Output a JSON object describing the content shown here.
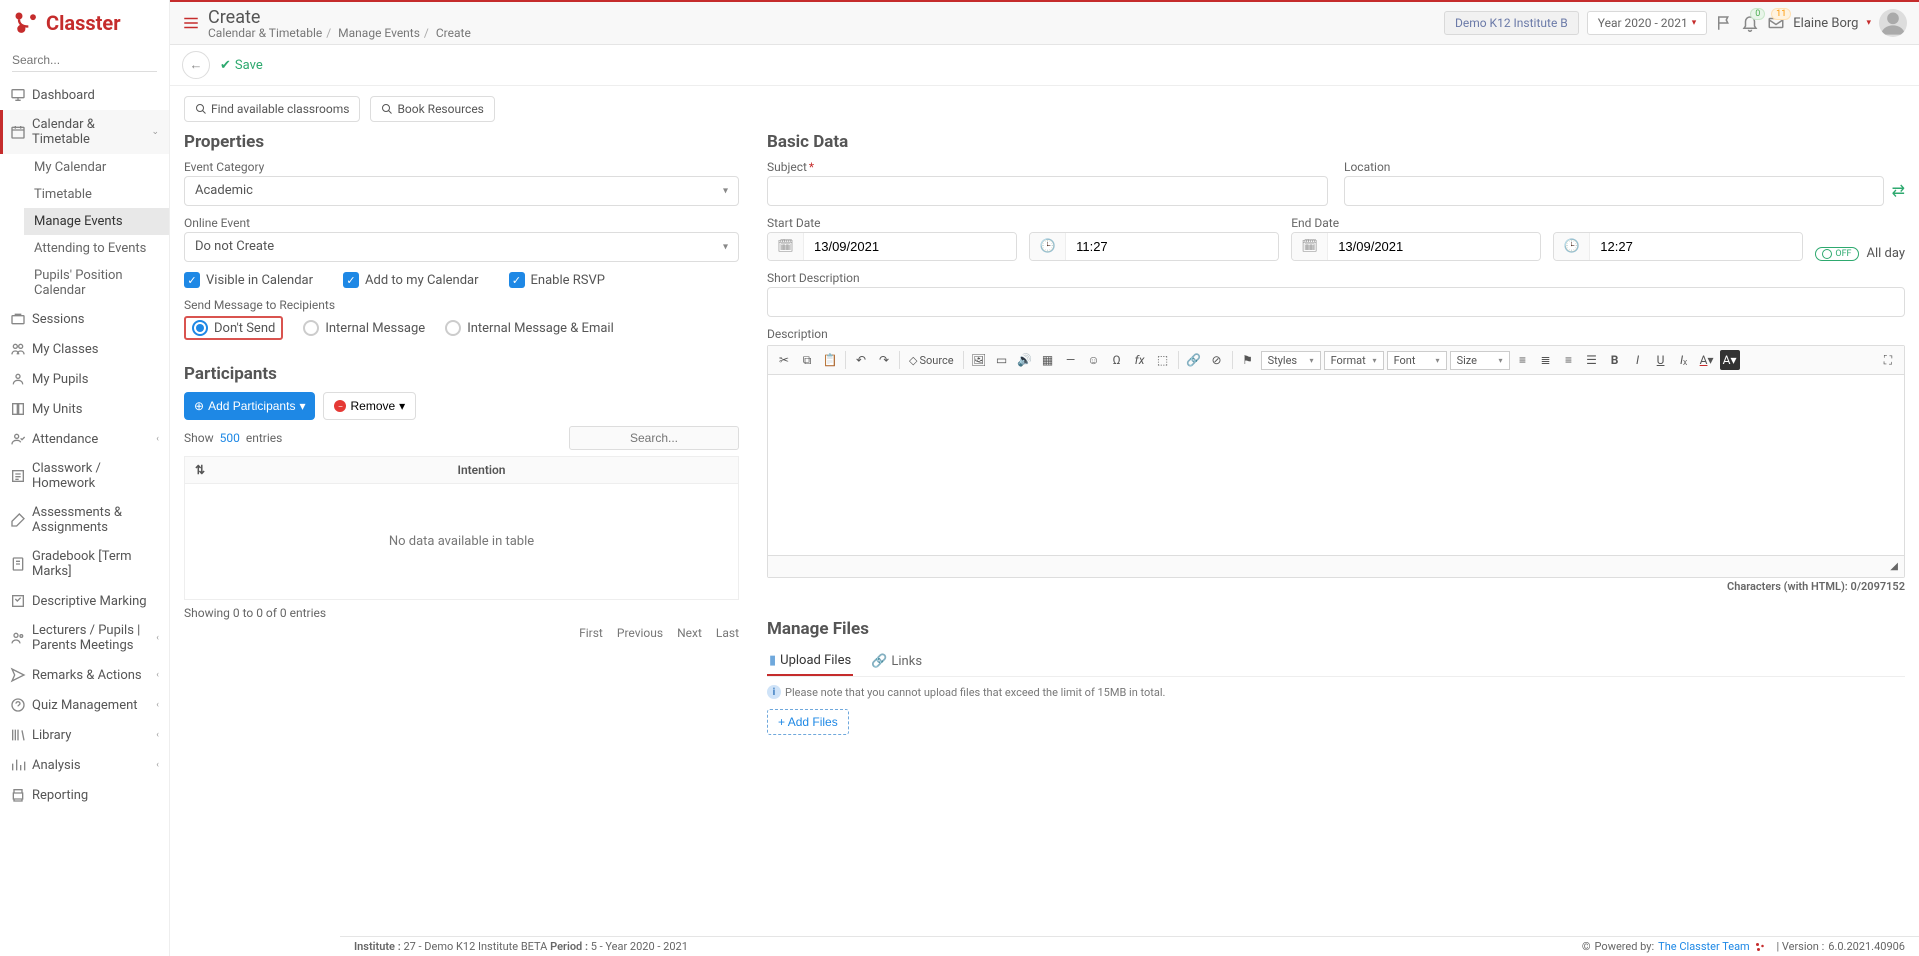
{
  "brand": "Classter",
  "sidebar_search_placeholder": "Search...",
  "nav": {
    "dashboard": "Dashboard",
    "calendar": "Calendar & Timetable",
    "calendar_sub": {
      "my_calendar": "My Calendar",
      "timetable": "Timetable",
      "manage_events": "Manage Events",
      "attending": "Attending to Events",
      "pupils_position": "Pupils' Position Calendar"
    },
    "sessions": "Sessions",
    "my_classes": "My Classes",
    "my_pupils": "My Pupils",
    "my_units": "My Units",
    "attendance": "Attendance",
    "classwork": "Classwork / Homework",
    "assessments": "Assessments & Assignments",
    "gradebook": "Gradebook [Term Marks]",
    "descriptive": "Descriptive Marking",
    "lecturers": "Lecturers / Pupils | Parents Meetings",
    "remarks": "Remarks & Actions",
    "quiz": "Quiz Management",
    "library": "Library",
    "analysis": "Analysis",
    "reporting": "Reporting"
  },
  "header": {
    "title": "Create",
    "crumb1": "Calendar & Timetable",
    "crumb2": "Manage Events",
    "crumb3": "Create",
    "institute": "Demo K12 Institute B",
    "year": "Year 2020 - 2021",
    "bell_count": "0",
    "msg_count": "11",
    "user": "Elaine Borg"
  },
  "actions": {
    "save": "Save",
    "find_classrooms": "Find available classrooms",
    "book_resources": "Book Resources"
  },
  "properties": {
    "title": "Properties",
    "event_category_label": "Event Category",
    "event_category_value": "Academic",
    "online_event_label": "Online Event",
    "online_event_value": "Do not Create",
    "visible_in_calendar": "Visible in Calendar",
    "add_to_my_calendar": "Add to my Calendar",
    "enable_rsvp": "Enable RSVP",
    "send_message_label": "Send Message to Recipients",
    "radio_dont_send": "Don't Send",
    "radio_internal": "Internal Message",
    "radio_internal_email": "Internal Message & Email"
  },
  "participants": {
    "title": "Participants",
    "add_btn": "Add Participants",
    "remove_btn": "Remove",
    "show_prefix": "Show",
    "show_n": "500",
    "show_suffix": "entries",
    "search_placeholder": "Search...",
    "col_intention": "Intention",
    "empty": "No data available in table",
    "info": "Showing 0 to 0 of 0 entries",
    "first": "First",
    "prev": "Previous",
    "next": "Next",
    "last": "Last"
  },
  "basic": {
    "title": "Basic Data",
    "subject_label": "Subject",
    "location_label": "Location",
    "start_label": "Start Date",
    "end_label": "End Date",
    "start_date": "13/09/2021",
    "start_time": "11:27",
    "end_date": "13/09/2021",
    "end_time": "12:27",
    "all_day": "All day",
    "toggle_off": "OFF",
    "short_desc_label": "Short Description",
    "desc_label": "Description"
  },
  "editor": {
    "source": "Source",
    "styles": "Styles",
    "format": "Format",
    "font": "Font",
    "size": "Size",
    "char_count": "Characters (with HTML): 0/2097152"
  },
  "files": {
    "title": "Manage Files",
    "tab_upload": "Upload Files",
    "tab_links": "Links",
    "note": "Please note that you cannot upload files that exceed the limit of 15MB in total.",
    "add_files": "Add Files"
  },
  "footer": {
    "inst_label": "Institute :",
    "inst_val": "27 - Demo K12 Institute BETA",
    "period_label": "Period :",
    "period_val": "5 - Year 2020 - 2021",
    "powered": "Powered by:",
    "team": "The Classter Team",
    "version_label": "| Version :",
    "version": "6.0.2021.40906"
  }
}
